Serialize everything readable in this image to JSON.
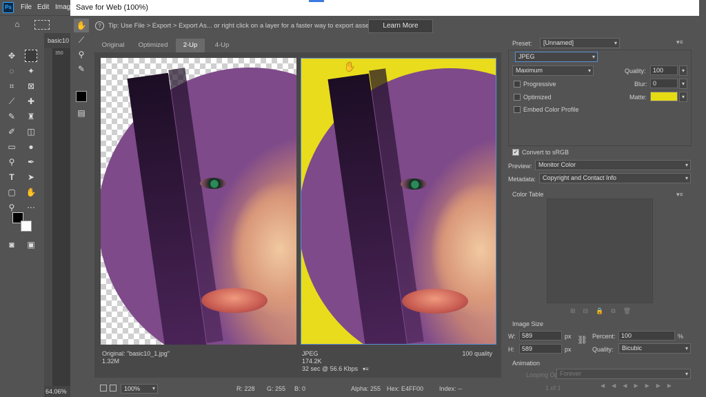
{
  "ps": {
    "logo": "Ps",
    "menu": [
      "File",
      "Edit",
      "Imag"
    ],
    "doc_tab": "basic10",
    "ruler_label": "350",
    "zoom": "64.06%"
  },
  "dialog": {
    "title": "Save for Web (100%)",
    "tip_icon": "?",
    "tip": "Tip: Use File > Export > Export As...  or right click on a layer for a faster way to export assets",
    "learn_more": "Learn More",
    "tabs": [
      "Original",
      "Optimized",
      "2-Up",
      "4-Up"
    ],
    "active_tab": "2-Up"
  },
  "left_pane": {
    "line1": "Original: \"basic10_1.jpg\"",
    "line2": "1.32M"
  },
  "right_pane": {
    "format": "JPEG",
    "size": "174.2K",
    "time": "32 sec @ 56.6 Kbps",
    "quality": "100 quality",
    "menu": "▾≡"
  },
  "statusbar": {
    "zoom": "100%",
    "r": "R: 228",
    "g": "G: 255",
    "b": "B: 0",
    "alpha": "Alpha: 255",
    "hex": "Hex: E4FF00",
    "index": "Index: --"
  },
  "settings": {
    "preset_label": "Preset:",
    "preset_value": "[Unnamed]",
    "format_value": "JPEG",
    "compression_value": "Maximum",
    "quality_label": "Quality:",
    "quality_value": "100",
    "progressive_label": "Progressive",
    "blur_label": "Blur:",
    "blur_value": "0",
    "optimized_label": "Optimized",
    "matte_label": "Matte:",
    "matte_color": "#e6dc14",
    "embed_label": "Embed Color Profile",
    "convert_label": "Convert to sRGB",
    "convert_checked": "✓",
    "preview_label": "Preview:",
    "preview_value": "Monitor Color",
    "metadata_label": "Metadata:",
    "metadata_value": "Copyright and Contact Info",
    "color_table_label": "Color Table",
    "image_size_label": "Image Size",
    "w_label": "W:",
    "w_value": "589",
    "h_label": "H:",
    "h_value": "589",
    "px": "px",
    "percent_label": "Percent:",
    "percent_value": "100",
    "percent_sign": "%",
    "resample_label": "Quality:",
    "resample_value": "Bicubic",
    "animation_label": "Animation",
    "looping_label": "Looping Options:",
    "looping_value": "Forever",
    "frame_counter": "1 of 1"
  }
}
